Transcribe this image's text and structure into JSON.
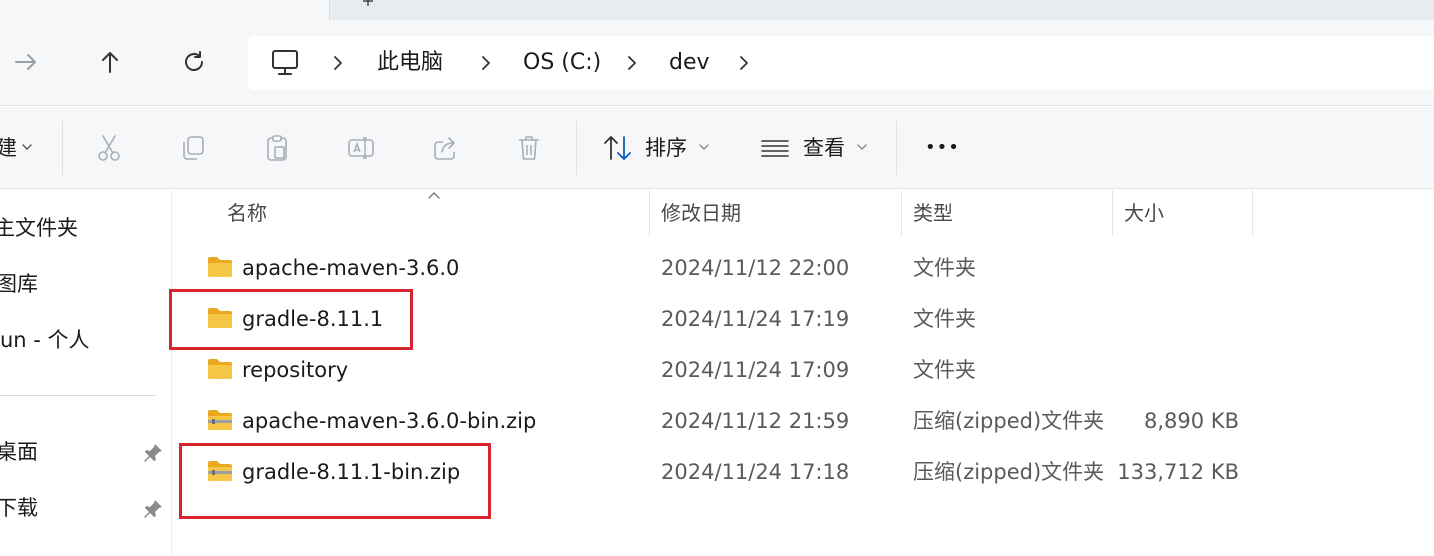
{
  "address": {
    "segments": [
      "此电脑",
      "OS (C:)",
      "dev"
    ]
  },
  "toolbar": {
    "new_fragment": "建",
    "sort_label": "排序",
    "view_label": "查看",
    "more_label": "•••"
  },
  "sidebar": {
    "items": [
      "主文件夹",
      "图库",
      "un - 个人",
      "桌面",
      "下载"
    ]
  },
  "columns": {
    "name": "名称",
    "date": "修改日期",
    "type": "类型",
    "size": "大小"
  },
  "files": [
    {
      "name": "apache-maven-3.6.0",
      "date": "2024/11/12 22:00",
      "type": "文件夹",
      "size": "",
      "icon": "folder-icon"
    },
    {
      "name": "gradle-8.11.1",
      "date": "2024/11/24 17:19",
      "type": "文件夹",
      "size": "",
      "icon": "folder-icon"
    },
    {
      "name": "repository",
      "date": "2024/11/24 17:09",
      "type": "文件夹",
      "size": "",
      "icon": "folder-icon"
    },
    {
      "name": "apache-maven-3.6.0-bin.zip",
      "date": "2024/11/12 21:59",
      "type": "压缩(zipped)文件夹",
      "size": "8,890 KB",
      "icon": "zip-folder-icon"
    },
    {
      "name": "gradle-8.11.1-bin.zip",
      "date": "2024/11/24 17:18",
      "type": "压缩(zipped)文件夹",
      "size": "133,712 KB",
      "icon": "zip-folder-icon"
    }
  ],
  "colors": {
    "highlight": "#d9262e",
    "folder": "#f6c744"
  }
}
